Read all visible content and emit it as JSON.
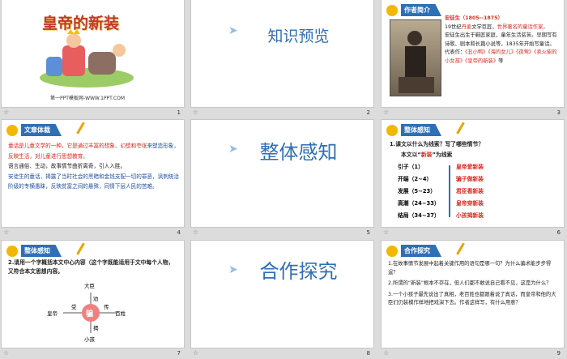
{
  "s1": {
    "title": "皇帝的新装",
    "caption": "第一PPT模板网-WWW.1PPT.COM",
    "num": "1"
  },
  "s2": {
    "title": "知识预览",
    "num": "2"
  },
  "s3": {
    "header": "作者简介",
    "line1a": "安徒生（1805--1875）",
    "line2a": "19世纪",
    "line2b": "丹麦",
    "line2c": "文学巨匠，",
    "line2d": "世界著名的童话作家。",
    "line3": "安徒生出生于鞋匠家庭，童年生活贫苦。早期写有诗歌、剧本和长篇小说等，1835年开始写童话。",
    "line4a": "代表作：",
    "line4b": "《丑小鸭》《海的女儿》《夜莺》《卖火柴的小女孩》《皇帝的新装》",
    "line4c": "等",
    "num": "3"
  },
  "s4": {
    "header": "文章体裁",
    "p1a": "童话是儿童文学的一种，它是通过丰富的",
    "p1b": "想象、幻想和夸张",
    "p1c": "来塑造形象，",
    "p1d": "反映生活，对儿童进行思想教育。",
    "p2": "语言通俗、生动，故事情节曲折离奇，引人入胜。",
    "p3": "安徒生的童话，揭露了当时社会的黑暗和金钱支配一切的罪恶，讽刺统治阶级的专横愚昧，反映贫富之间的悬殊，同情下层人民的苦难。",
    "num": "4"
  },
  "s5": {
    "title": "整体感知",
    "num": "5"
  },
  "s6": {
    "header": "整体感知",
    "q": "1.课文以什么为线索？写了哪些情节？",
    "clue_a": "本文以“",
    "clue_b": "新装",
    "clue_c": "”为线索",
    "rows": [
      {
        "l": "引子（1）",
        "r": "皇帝爱新装"
      },
      {
        "l": "开端（2~4）",
        "r": "骗子做新装"
      },
      {
        "l": "发展（5~23）",
        "r": "君臣看新装"
      },
      {
        "l": "高潮（24~33）",
        "r": "皇帝穿新装"
      },
      {
        "l": "结局（34~37）",
        "r": "小孩揭新装"
      }
    ],
    "num": "6"
  },
  "s7": {
    "header": "整体感知",
    "q": "2.请用一个字概括本文中心内容（这个字既能适用于文中每个人物，又符合本文思想内容。",
    "center": "骗",
    "labels": {
      "top": "大臣",
      "left": "皇帝",
      "right": "百姓",
      "bottom": "小孩",
      "a1": "受",
      "a2": "劝",
      "a3": "传",
      "a4": "揭"
    },
    "num": "7"
  },
  "s8": {
    "title": "合作探究",
    "num": "8"
  },
  "s9": {
    "header": "合作探究",
    "q1": "1.在故事情节发展中起着关键作用的语句是哪一句？为什么骗术能步步得逞？",
    "q2": "2.所谓的“新装”根本不存在，但人们都不敢说自己看不见，这是为什么？",
    "q3": "3.一个小孩子最先说出了真相，老百姓也都跟着说了真话，而皇帝和他的大臣们仍装模作样地把戏演下去。作者这样写，有什么用意？",
    "num": "9"
  }
}
